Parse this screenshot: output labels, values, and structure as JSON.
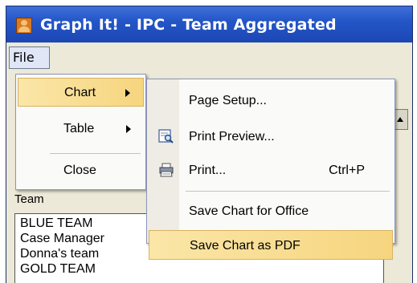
{
  "window": {
    "title": "Graph It! - IPC - Team Aggregated",
    "app_icon": "user-icon"
  },
  "menubar": {
    "file_label": "File"
  },
  "file_menu": {
    "items": [
      {
        "label": "Chart",
        "submenu": true,
        "highlighted": true
      },
      {
        "label": "Table",
        "submenu": true,
        "highlighted": false
      },
      {
        "label": "Close",
        "submenu": false,
        "highlighted": false
      }
    ]
  },
  "chart_submenu": {
    "items": [
      {
        "label": "Page Setup...",
        "icon": "",
        "shortcut": ""
      },
      {
        "label": "Print Preview...",
        "icon": "print-preview-icon",
        "shortcut": ""
      },
      {
        "label": "Print...",
        "icon": "printer-icon",
        "shortcut": "Ctrl+P"
      },
      {
        "label": "Save Chart for Office",
        "icon": "",
        "shortcut": ""
      },
      {
        "label": "Save Chart as PDF",
        "icon": "",
        "shortcut": "",
        "highlighted": true
      }
    ]
  },
  "background": {
    "team_label": "Team",
    "team_list": [
      "BLUE TEAM",
      "Case Manager",
      "Donna's team",
      "GOLD TEAM"
    ]
  },
  "colors": {
    "title_bar": "#2456c8",
    "highlight": "#f6d57e",
    "menu_bg": "#fafaf8"
  }
}
